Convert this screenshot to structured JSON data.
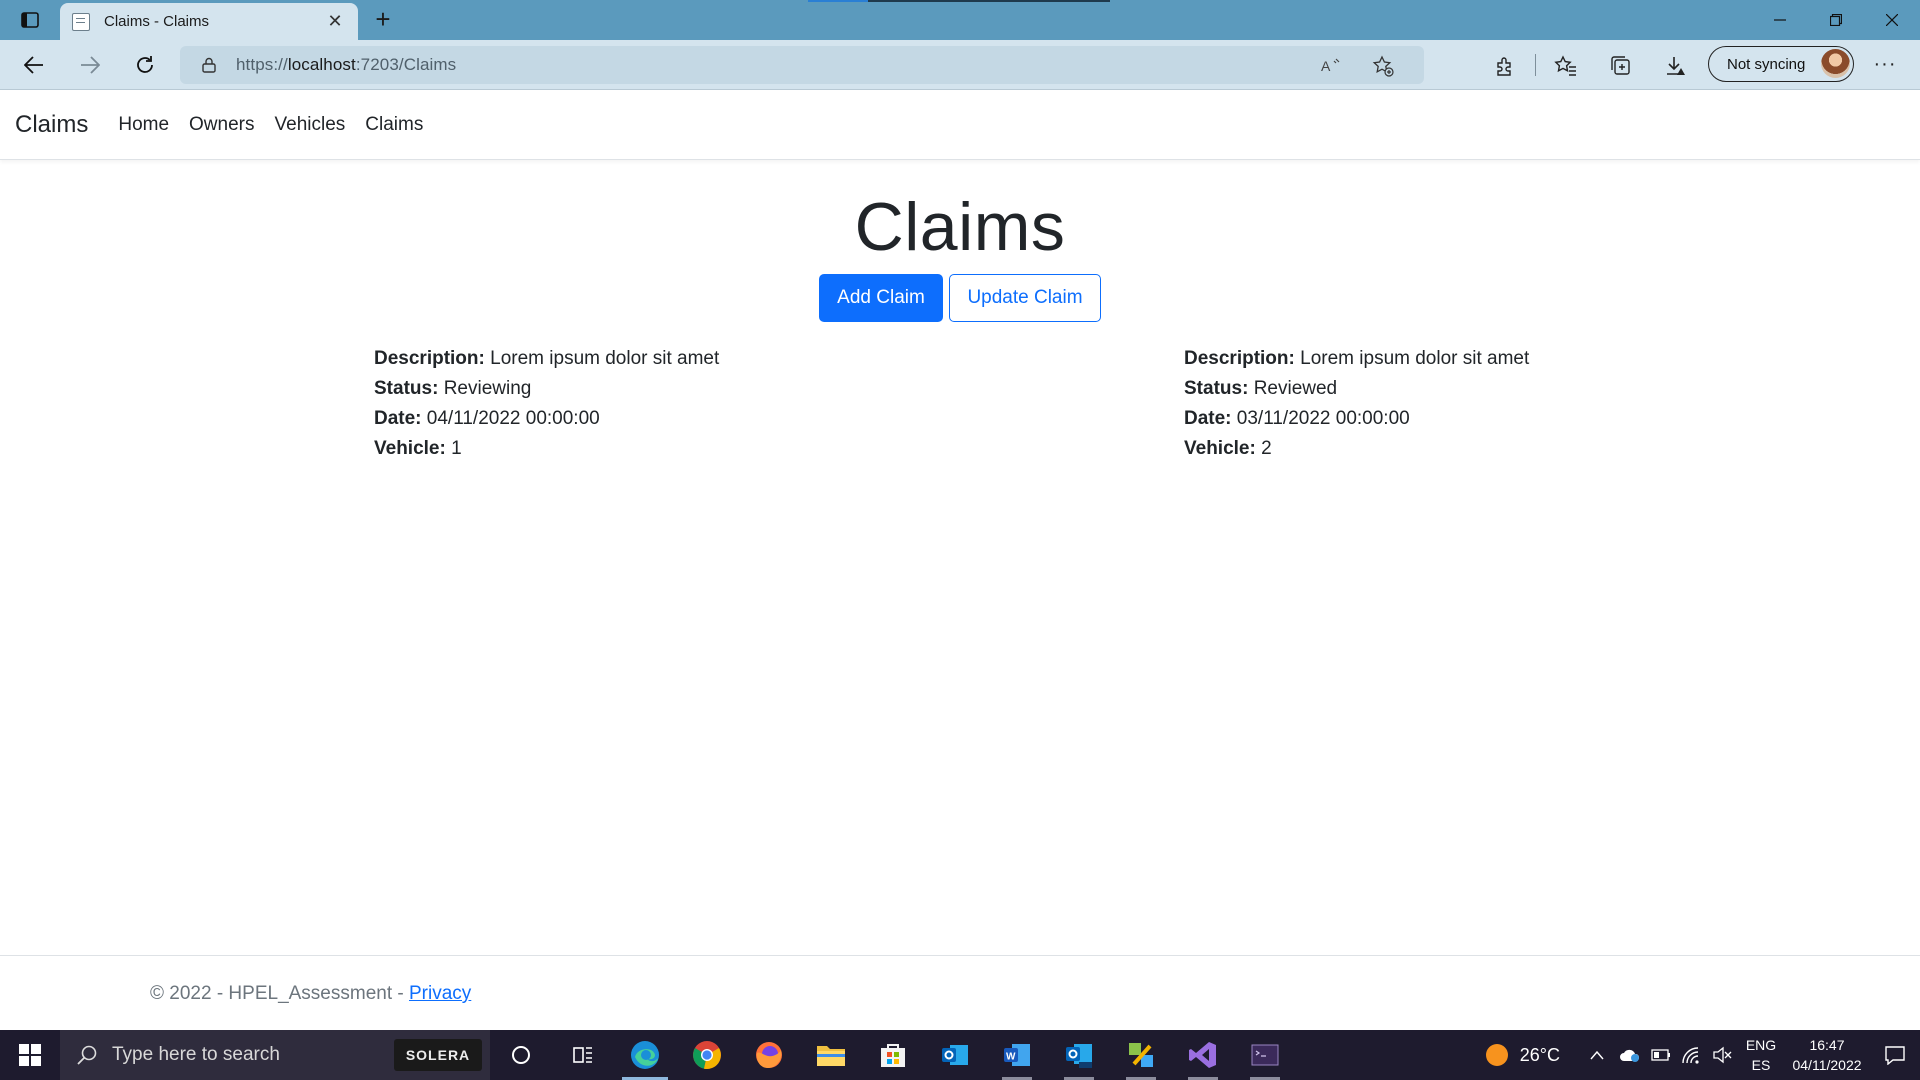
{
  "browser": {
    "tab_title": "Claims - Claims",
    "url_scheme": "https://",
    "url_host": "localhost",
    "url_rest": ":7203/Claims",
    "sync_label": "Not syncing"
  },
  "nav": {
    "brand": "Claims",
    "links": [
      "Home",
      "Owners",
      "Vehicles",
      "Claims"
    ]
  },
  "page": {
    "title": "Claims",
    "add_button": "Add Claim",
    "update_button": "Update Claim"
  },
  "claims": [
    {
      "description_label": "Description:",
      "description": "Lorem ipsum dolor sit amet",
      "status_label": "Status:",
      "status": "Reviewing",
      "date_label": "Date:",
      "date": "04/11/2022 00:00:00",
      "vehicle_label": "Vehicle:",
      "vehicle": "1"
    },
    {
      "description_label": "Description:",
      "description": "Lorem ipsum dolor sit amet",
      "status_label": "Status:",
      "status": "Reviewed",
      "date_label": "Date:",
      "date": "03/11/2022 00:00:00",
      "vehicle_label": "Vehicle:",
      "vehicle": "2"
    }
  ],
  "footer": {
    "text": "© 2022 - HPEL_Assessment - ",
    "privacy_link": "Privacy"
  },
  "taskbar": {
    "search_placeholder": "Type here to search",
    "search_brand": "SOLERA",
    "temperature": "26°C",
    "lang_line1": "ENG",
    "lang_line2": "ES",
    "time": "16:47",
    "date": "04/11/2022"
  },
  "colors": {
    "primary": "#0d6efd",
    "titlebar": "#5b9abd",
    "toolbar": "#d4e4ee",
    "taskbar": "#1e1b2e"
  }
}
